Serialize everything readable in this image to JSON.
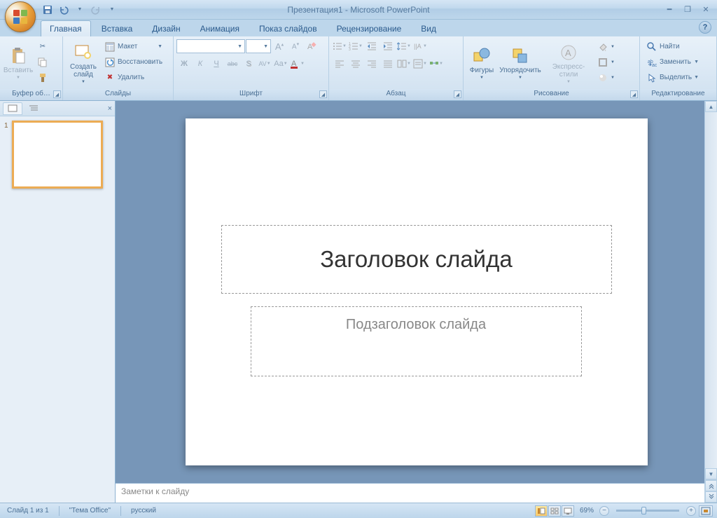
{
  "title": "Презентация1 - Microsoft PowerPoint",
  "qat": {
    "save": "save-icon",
    "undo": "undo-icon",
    "redo": "redo-icon"
  },
  "tabs": [
    "Главная",
    "Вставка",
    "Дизайн",
    "Анимация",
    "Показ слайдов",
    "Рецензирование",
    "Вид"
  ],
  "active_tab": 0,
  "ribbon": {
    "clipboard": {
      "label": "Буфер об…",
      "paste": "Вставить",
      "cut": "cut-icon",
      "copy": "copy-icon",
      "format_painter": "format-painter-icon"
    },
    "slides": {
      "label": "Слайды",
      "new_slide": "Создать\nслайд",
      "layout": "Макет",
      "reset": "Восстановить",
      "delete": "Удалить"
    },
    "font": {
      "label": "Шрифт",
      "name_placeholder": "",
      "size_placeholder": "",
      "bold": "Ж",
      "italic": "К",
      "underline": "Ч",
      "strike": "abc",
      "shadow": "S",
      "spacing": "AV",
      "case": "Aa",
      "grow": "A",
      "shrink": "A",
      "clear": "A"
    },
    "paragraph": {
      "label": "Абзац"
    },
    "drawing": {
      "label": "Рисование",
      "shapes": "Фигуры",
      "arrange": "Упорядочить",
      "styles": "Экспресс-стили"
    },
    "editing": {
      "label": "Редактирование",
      "find": "Найти",
      "replace": "Заменить",
      "select": "Выделить"
    }
  },
  "thumbs": {
    "slides": [
      {
        "num": "1"
      }
    ]
  },
  "slide": {
    "title_placeholder": "Заголовок слайда",
    "subtitle_placeholder": "Подзаголовок слайда"
  },
  "notes": {
    "placeholder": "Заметки к слайду"
  },
  "status": {
    "slide_info": "Слайд 1 из 1",
    "theme": "\"Тема Office\"",
    "lang": "русский",
    "zoom": "69%"
  }
}
